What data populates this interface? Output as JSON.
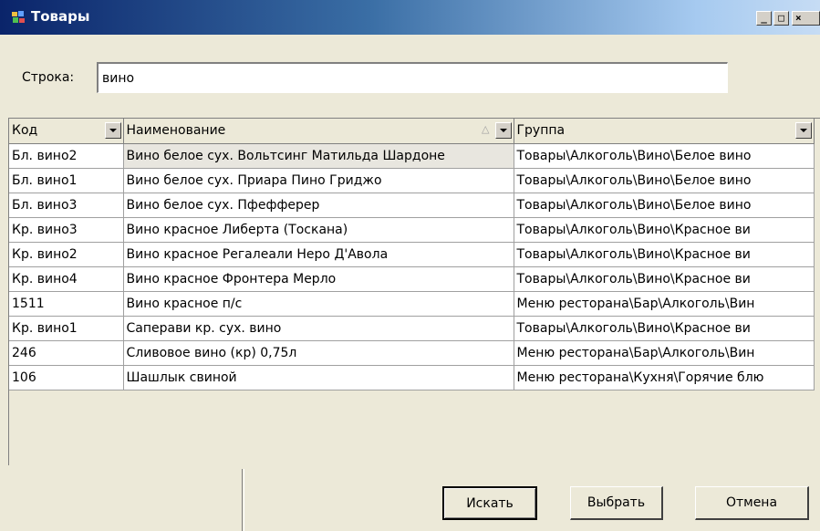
{
  "window": {
    "title": "Товары",
    "buttons": {
      "minimize": "_",
      "maximize": "□",
      "close": "×"
    }
  },
  "search": {
    "label": "Строка:",
    "value": "вино"
  },
  "grid": {
    "columns": [
      {
        "key": "code",
        "label": "Код"
      },
      {
        "key": "name",
        "label": "Наименование",
        "sort": "ascending"
      },
      {
        "key": "group",
        "label": "Группа"
      }
    ],
    "rows": [
      {
        "code": "Бл. вино2",
        "name": "Вино белое сух. Вольтсинг Матильда Шардоне",
        "group": "Товары\\Алкоголь\\Вино\\Белое вино"
      },
      {
        "code": "Бл. вино1",
        "name": "Вино белое сух. Приара Пино Гриджо",
        "group": "Товары\\Алкоголь\\Вино\\Белое вино"
      },
      {
        "code": "Бл. вино3",
        "name": "Вино белое сух. Пфефферер",
        "group": "Товары\\Алкоголь\\Вино\\Белое вино"
      },
      {
        "code": "Кр. вино3",
        "name": "Вино красное Либерта (Тоскана)",
        "group": "Товары\\Алкоголь\\Вино\\Красное ви"
      },
      {
        "code": "Кр. вино2",
        "name": "Вино красное Регалеали Неро Д'Авола",
        "group": "Товары\\Алкоголь\\Вино\\Красное ви"
      },
      {
        "code": "Кр. вино4",
        "name": "Вино красное Фронтера Мерло",
        "group": "Товары\\Алкоголь\\Вино\\Красное ви"
      },
      {
        "code": "1511",
        "name": "Вино красное п/с",
        "group": "Меню ресторана\\Бар\\Алкоголь\\Вин"
      },
      {
        "code": "Кр. вино1",
        "name": "Саперави кр. сух. вино",
        "group": "Товары\\Алкоголь\\Вино\\Красное ви"
      },
      {
        "code": "246",
        "name": "Сливовое вино (кр) 0,75л",
        "group": "Меню ресторана\\Бар\\Алкоголь\\Вин"
      },
      {
        "code": "106",
        "name": "Шашлык свиной",
        "group": "Меню ресторана\\Кухня\\Горячие блю"
      }
    ]
  },
  "buttons": {
    "search": "Искать",
    "select": "Выбрать",
    "cancel": "Отмена"
  }
}
